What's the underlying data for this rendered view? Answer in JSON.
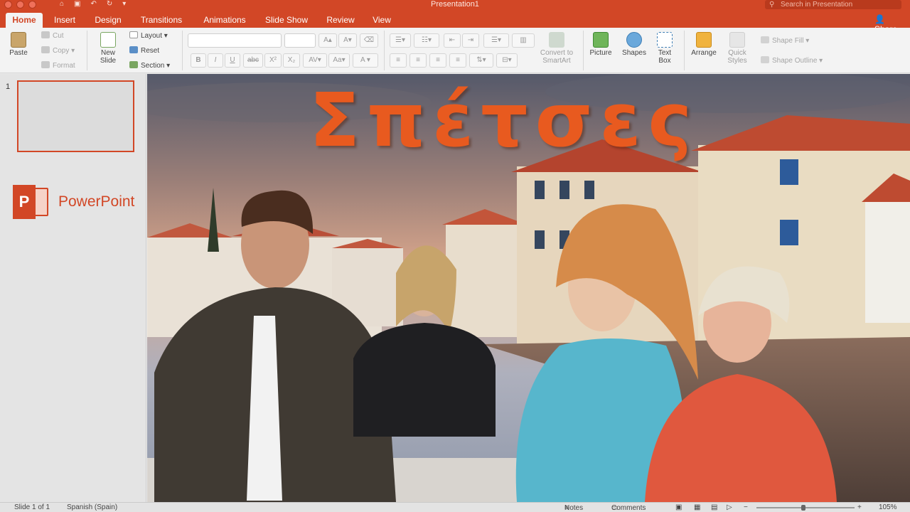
{
  "window": {
    "title": "Presentation1",
    "search_placeholder": "Search in Presentation",
    "share_label": "Share"
  },
  "tabs": [
    "Home",
    "Insert",
    "Design",
    "Transitions",
    "Animations",
    "Slide Show",
    "Review",
    "View"
  ],
  "ribbon": {
    "paste": "Paste",
    "cut": "Cut",
    "copy": "Copy",
    "format": "Format",
    "new_slide": "New Slide",
    "layout": "Layout",
    "reset": "Reset",
    "section": "Section",
    "convert_smartart": "Convert to SmartArt",
    "picture": "Picture",
    "shapes": "Shapes",
    "text_box": "Text Box",
    "arrange": "Arrange",
    "quick_styles": "Quick Styles",
    "shape_fill": "Shape Fill",
    "shape_outline": "Shape Outline",
    "font_buttons": [
      "B",
      "I",
      "U",
      "abc",
      "X²",
      "X₂"
    ]
  },
  "thumbnail_pane": {
    "slide_number": "1",
    "app_name": "PowerPoint"
  },
  "slide": {
    "title": "Σπέτσες"
  },
  "status": {
    "slide_position": "Slide 1 of 1",
    "language": "Spanish (Spain)",
    "notes": "Notes",
    "comments": "Comments",
    "zoom": "105%",
    "zoom_fraction": 0.48
  },
  "colors": {
    "accent": "#d24726",
    "title_text": "#e85a1f"
  }
}
